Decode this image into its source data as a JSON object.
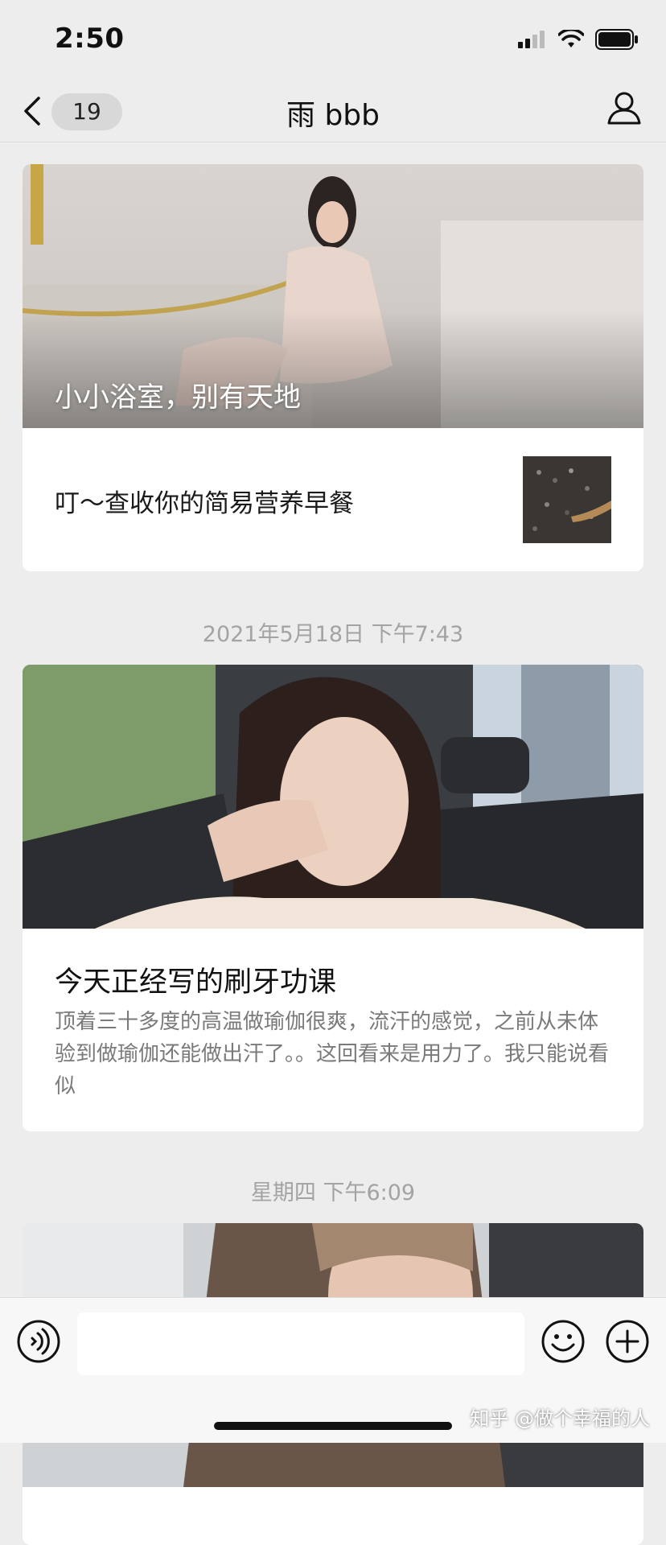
{
  "status_bar": {
    "time": "2:50",
    "icons": [
      "signal-icon",
      "wifi-icon",
      "battery-icon"
    ]
  },
  "nav": {
    "back_icon": "chevron-left-icon",
    "unread_count": "19",
    "title": "雨 bbb",
    "profile_icon": "person-icon"
  },
  "articles": [
    {
      "cover_title": "小小浴室，别有天地",
      "items": [
        {
          "title": "叮～查收你的简易营养早餐"
        }
      ]
    },
    {
      "timestamp": "2021年5月18日 下午7:43",
      "title": "今天正经写的刷牙功课",
      "summary": "顶着三十多度的高温做瑜伽很爽，流汗的感觉，之前从未体验到做瑜伽还能做出汗了。。这回看来是用力了。我只能说看似"
    },
    {
      "timestamp": "星期四 下午6:09"
    }
  ],
  "input_bar": {
    "voice_icon": "voice-icon",
    "emoji_icon": "emoji-icon",
    "plus_icon": "plus-icon",
    "watermark": "知乎 @做个幸福的人"
  },
  "colors": {
    "background": "#ededed",
    "card": "#ffffff",
    "timestamp_text": "#a3a3a3"
  }
}
